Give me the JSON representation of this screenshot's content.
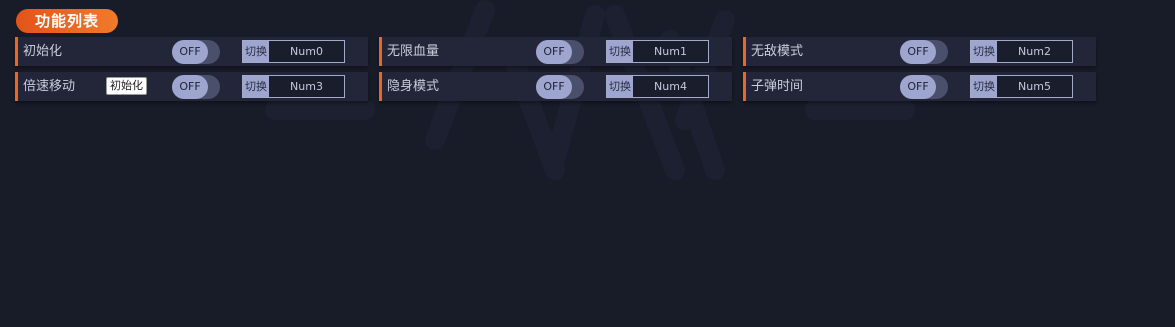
{
  "header": {
    "title": "功能列表"
  },
  "switch_label": "切换",
  "rows": [
    {
      "label": "初始化",
      "state": "OFF",
      "hotkey": "Num0"
    },
    {
      "label": "无限血量",
      "state": "OFF",
      "hotkey": "Num1"
    },
    {
      "label": "无敌模式",
      "state": "OFF",
      "hotkey": "Num2"
    },
    {
      "label": "倍速移动",
      "state": "OFF",
      "hotkey": "Num3"
    },
    {
      "label": "隐身模式",
      "state": "OFF",
      "hotkey": "Num4"
    },
    {
      "label": "子弹时间",
      "state": "OFF",
      "hotkey": "Num5"
    }
  ],
  "tooltip": {
    "text": "初始化"
  },
  "colors": {
    "background": "#181b28",
    "accent": "#e8672a",
    "row_bg": "#232638",
    "toggle_knob": "#9ea5cf"
  }
}
